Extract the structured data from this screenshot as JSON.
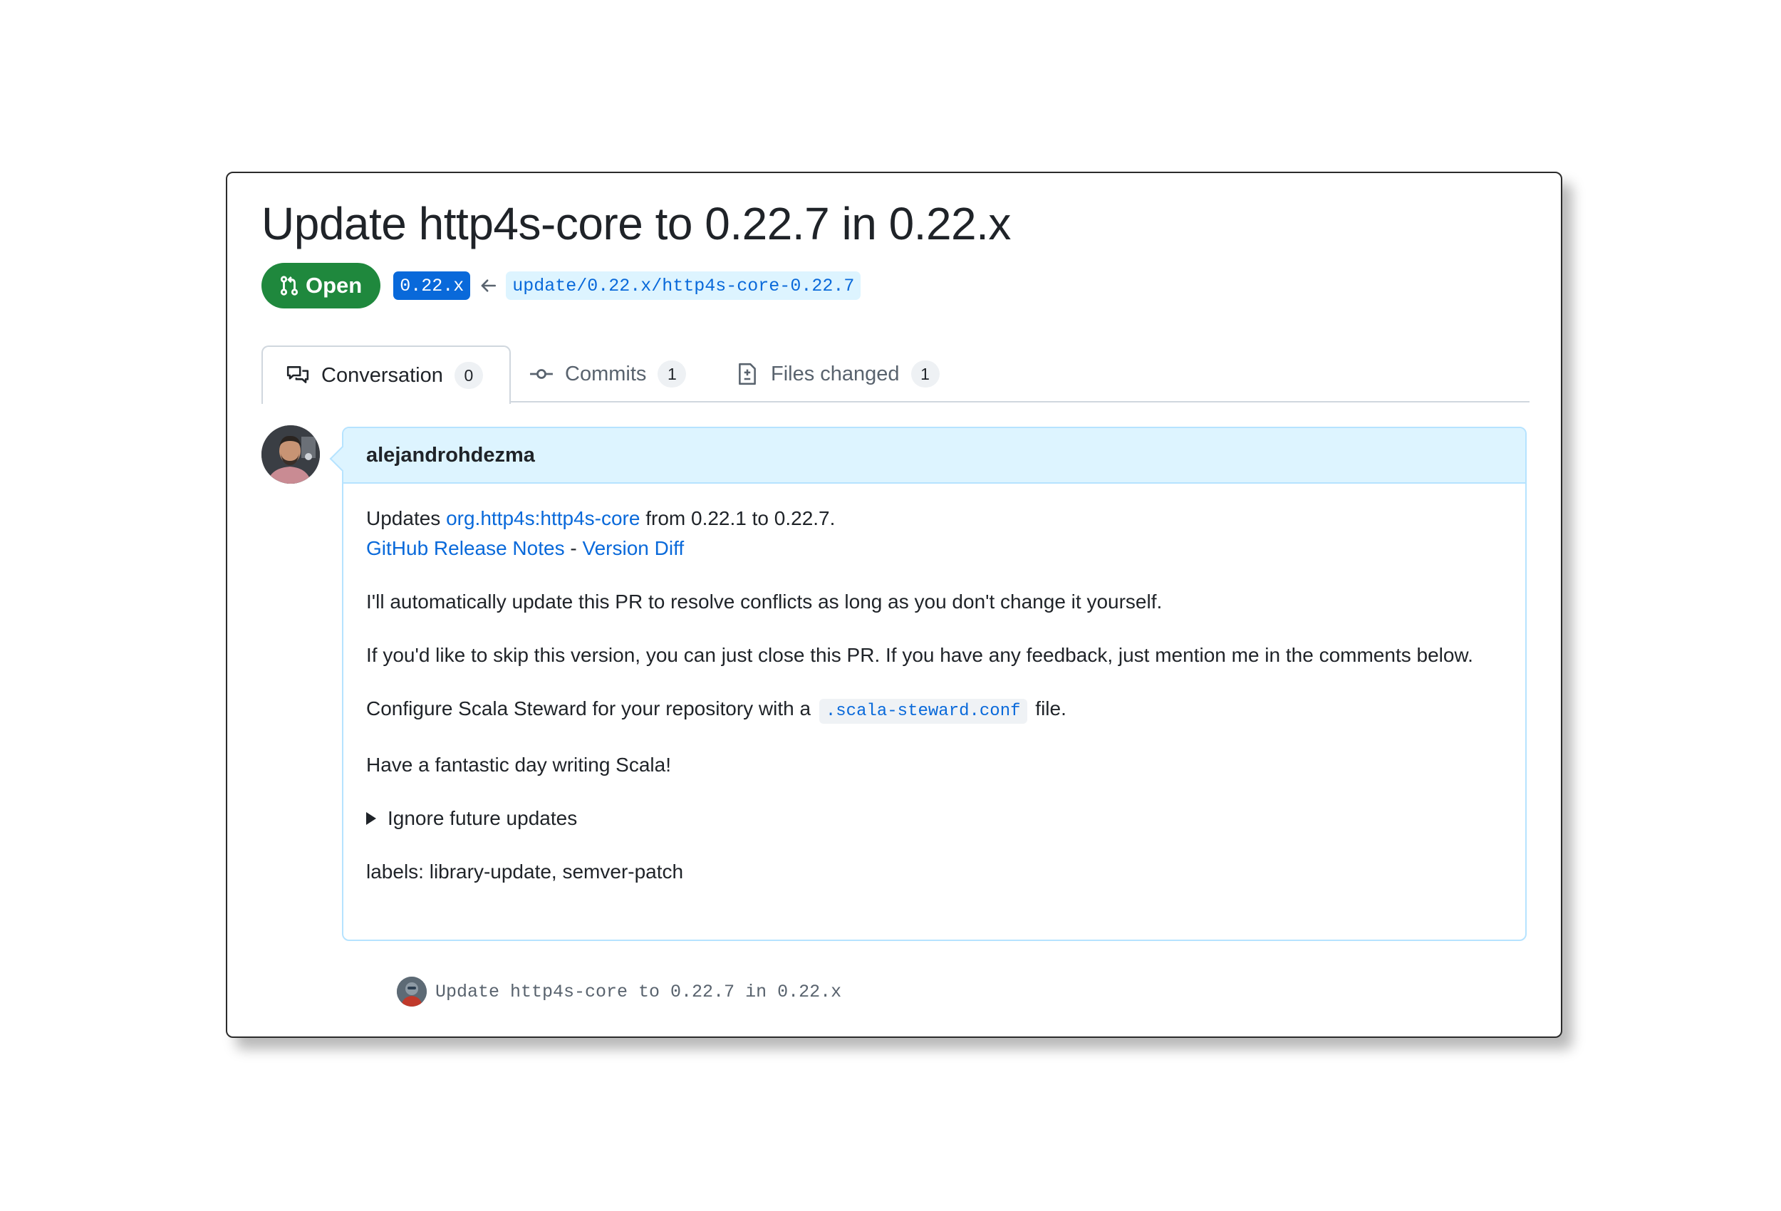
{
  "pr": {
    "title": "Update http4s-core to 0.22.7 in 0.22.x",
    "state_label": "Open",
    "base_ref": "0.22.x",
    "head_ref": "update/0.22.x/http4s-core-0.22.7"
  },
  "tabs": [
    {
      "label": "Conversation",
      "count": "0",
      "icon": "comment-discussion-icon",
      "active": true
    },
    {
      "label": "Commits",
      "count": "1",
      "icon": "git-commit-icon",
      "active": false
    },
    {
      "label": "Files changed",
      "count": "1",
      "icon": "file-diff-icon",
      "active": false
    }
  ],
  "comment": {
    "author": "alejandrohdezma",
    "updates_prefix": "Updates ",
    "artifact_link": "org.http4s:http4s-core",
    "updates_suffix": " from 0.22.1 to 0.22.7.",
    "release_notes_link": "GitHub Release Notes",
    "separator": " - ",
    "version_diff_link": "Version Diff",
    "auto_update_text": "I'll automatically update this PR to resolve conflicts as long as you don't change it yourself.",
    "skip_text": "If you'd like to skip this version, you can just close this PR. If you have any feedback, just mention me in the comments below.",
    "configure_prefix": "Configure Scala Steward for your repository with a ",
    "config_file": ".scala-steward.conf",
    "configure_suffix": " file.",
    "closing_text": "Have a fantastic day writing Scala!",
    "details_summary": "Ignore future updates",
    "labels_text": "labels: library-update, semver-patch"
  },
  "commit": {
    "message": "Update http4s-core to 0.22.7 in 0.22.x"
  },
  "colors": {
    "open_green": "#1f883d",
    "link_blue": "#0969da",
    "comment_header_bg": "#ddf4ff",
    "comment_border": "#b6e3ff"
  }
}
